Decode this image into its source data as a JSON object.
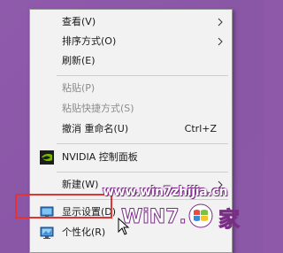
{
  "menu": {
    "items": [
      {
        "label": "查看(V)"
      },
      {
        "label": "排序方式(O)"
      },
      {
        "label": "刷新(E)"
      },
      {
        "label": "粘贴(P)"
      },
      {
        "label": "粘贴快捷方式(S)"
      },
      {
        "label": "撤消 重命名(U)",
        "shortcut": "Ctrl+Z"
      },
      {
        "label": "NVIDIA 控制面板"
      },
      {
        "label": "新建(W)"
      },
      {
        "label": "显示设置(D)"
      },
      {
        "label": "个性化(R)"
      }
    ]
  },
  "icons": {
    "nvidia": "nvidia-icon",
    "display": "display-settings-icon",
    "personalize": "personalize-icon",
    "submenu": "chevron-right-icon"
  },
  "watermark": {
    "url": "www.win7zhijia.cn",
    "logo_text": "WiN7.",
    "logo_char": "家"
  },
  "colors": {
    "desktop_bg": "#8d59a8",
    "menu_bg": "#f2f2f2",
    "highlight_border": "#e53333",
    "nvidia_green": "#76b900"
  }
}
